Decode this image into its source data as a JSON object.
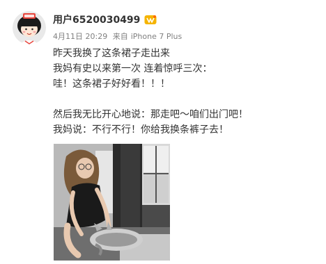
{
  "post": {
    "author": {
      "username": "用户6520030499",
      "avatar_icon": "cartoon-girl-avatar-icon",
      "badge_icon": "vip-membership-badge-icon"
    },
    "meta": {
      "timestamp": "4月11日 20:29",
      "source_prefix": "来自",
      "source_device": "iPhone 7 Plus"
    },
    "content": {
      "lines": [
        "昨天我换了这条裙子走出来",
        "我妈有史以来第一次 连着惊呼三次：",
        "哇！这条裙子好好看！！！",
        "",
        "然后我无比开心地说：那走吧～咱们出门吧！",
        "我妈说：不行不行！你给我换条裤子去！"
      ]
    },
    "image": {
      "description_icon": "photo-girl-with-cat-icon"
    }
  },
  "colors": {
    "username": "#333333",
    "meta_text": "#808080",
    "body_text": "#333333",
    "badge_gold": "#f5b400"
  }
}
